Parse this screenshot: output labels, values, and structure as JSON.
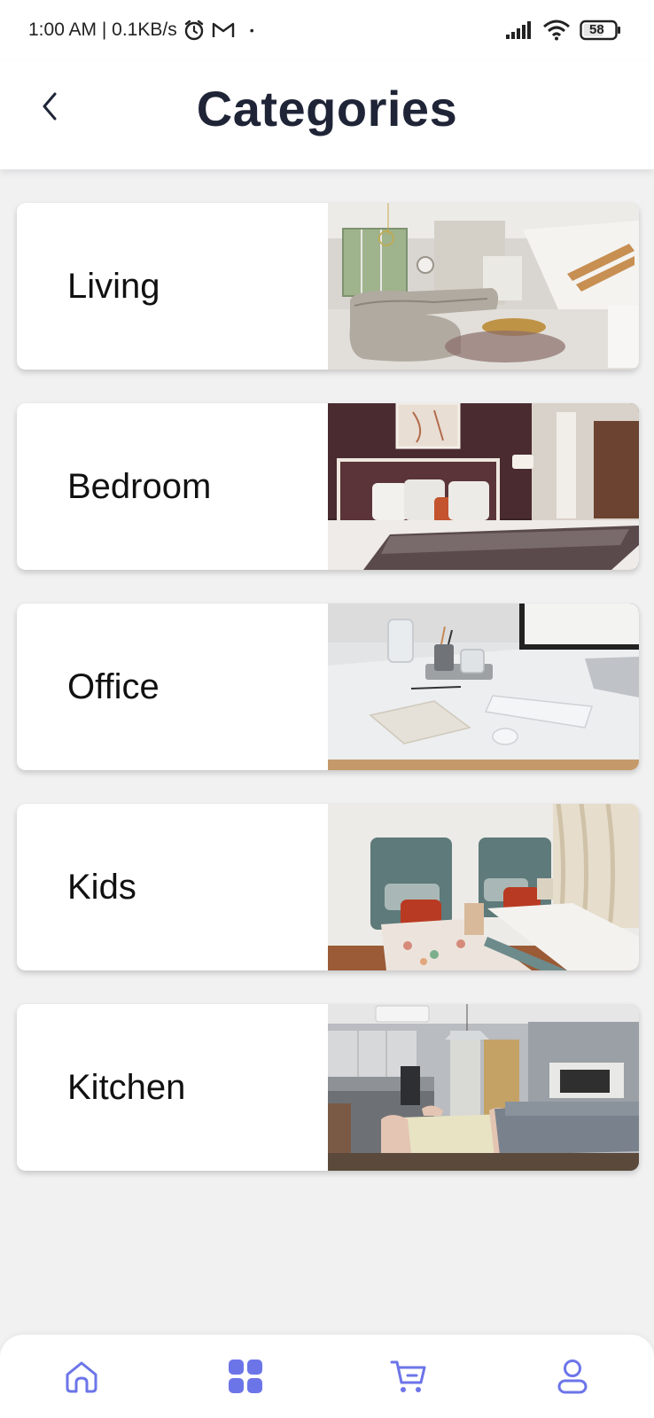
{
  "status_bar": {
    "time_speed": "1:00 AM | 0.1KB/s",
    "dot": "•",
    "battery": "58"
  },
  "header": {
    "title": "Categories"
  },
  "categories": [
    {
      "label": "Living",
      "image": "living-room-photo"
    },
    {
      "label": "Bedroom",
      "image": "bedroom-photo"
    },
    {
      "label": "Office",
      "image": "office-desk-photo"
    },
    {
      "label": "Kids",
      "image": "kids-room-photo"
    },
    {
      "label": "Kitchen",
      "image": "kitchen-photo"
    }
  ],
  "bottom_nav": {
    "items": [
      {
        "icon": "home-icon"
      },
      {
        "icon": "categories-grid-icon",
        "active": true
      },
      {
        "icon": "cart-icon"
      },
      {
        "icon": "profile-icon"
      }
    ]
  },
  "colors": {
    "accent": "#6c75e8",
    "title": "#1f2537",
    "background": "#f1f1f2"
  }
}
